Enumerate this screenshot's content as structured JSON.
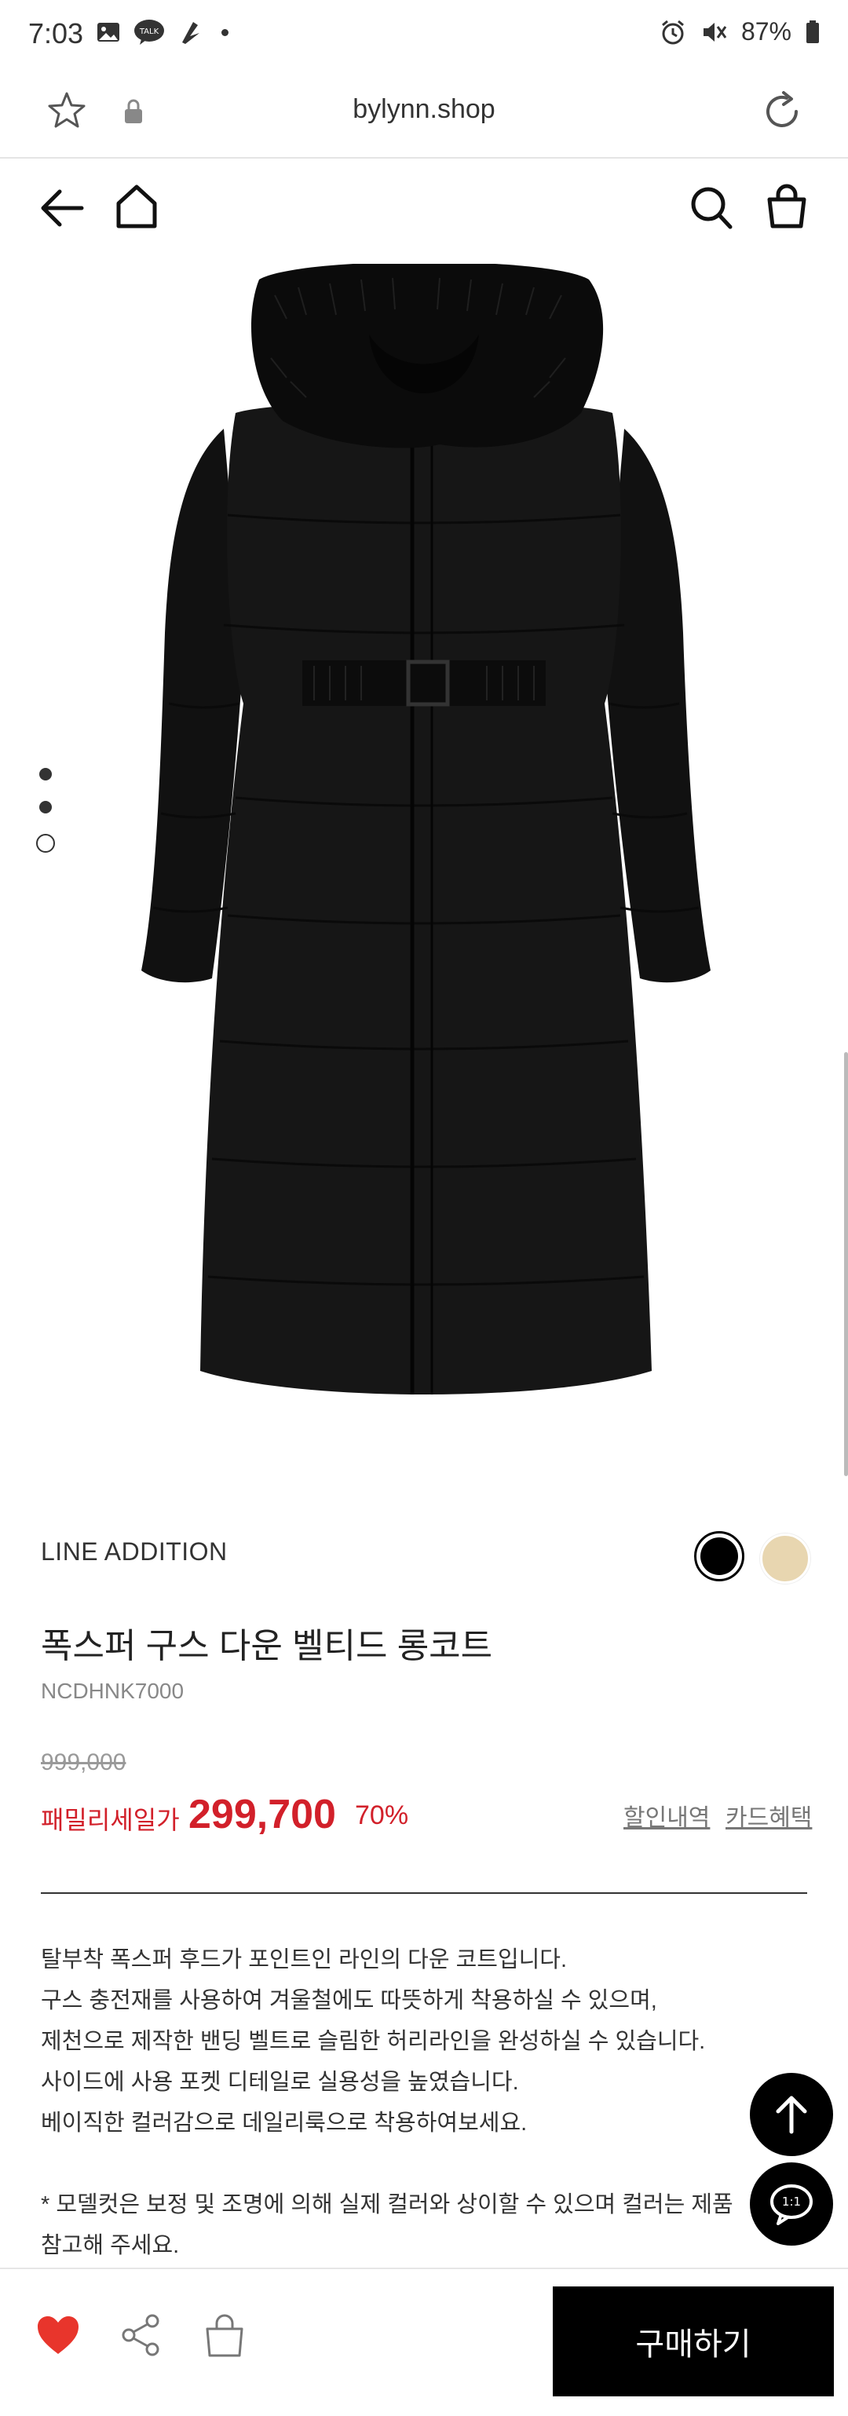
{
  "status_bar": {
    "time": "7:03",
    "battery": "87%"
  },
  "browser": {
    "url": "bylynn.shop"
  },
  "product": {
    "brand": "LINE ADDITION",
    "title": "폭스퍼 구스 다운 벨티드 롱코트",
    "code": "NCDHNK7000",
    "original_price": "999,000",
    "sale_label": "패밀리세일가",
    "sale_price": "299,700",
    "discount_rate": "70%",
    "discount_history_link": "할인내역",
    "card_benefit_link": "카드혜택",
    "colors": [
      "#000000",
      "#e8d6b0"
    ],
    "description_lines": [
      "탈부착 폭스퍼 후드가 포인트인 라인의 다운 코트입니다.",
      "구스 충전재를 사용하여 겨울철에도 따뜻하게 착용하실 수 있으며,",
      "제천으로 제작한 밴딩 벨트로 슬림한 허리라인을 완성하실 수 있습니다.",
      "사이드에 사용 포켓 디테일로 실용성을 높였습니다.",
      "베이직한 컬러감으로 데일리룩으로 착용하여보세요.",
      "",
      "* 모델컷은 보정 및 조명에 의해 실제 컬러와 상이할 수 있으며 컬러는 제품",
      "참고해 주세요."
    ]
  },
  "actions": {
    "buy_label": "구매하기",
    "chat_badge": "1:1"
  },
  "colors": {
    "sale_red": "#d2202a",
    "like_red": "#e8352c",
    "dark": "#000000"
  }
}
